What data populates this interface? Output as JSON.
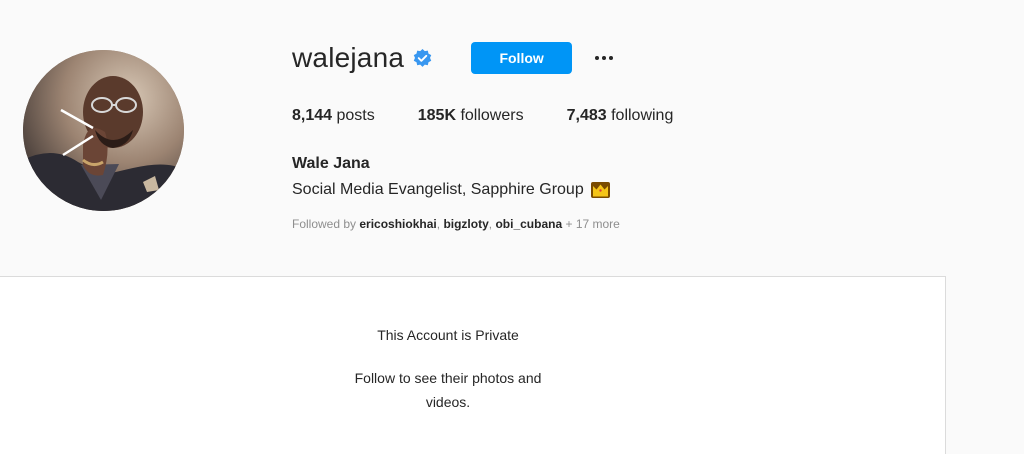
{
  "profile": {
    "username": "walejana",
    "verified": true,
    "follow_label": "Follow",
    "more_icon": "more-horizontal-icon",
    "stats": [
      {
        "num": "8,144",
        "label": "posts"
      },
      {
        "num": "185K",
        "label": "followers"
      },
      {
        "num": "7,483",
        "label": "following"
      }
    ],
    "full_name": "Wale Jana",
    "bio": "Social Media Evangelist, Sapphire Group",
    "bio_emoji": "crown-icon",
    "followed_by": {
      "prefix": "Followed by",
      "users": [
        "ericoshiokhai",
        "bigzloty",
        "obi_cubana"
      ],
      "more": "+ 17 more"
    }
  },
  "private": {
    "title": "This Account is Private",
    "subtitle": "Follow to see their photos and videos."
  },
  "colors": {
    "accent": "#0095f6",
    "background": "#fafafa",
    "border": "#dbdbdb"
  }
}
